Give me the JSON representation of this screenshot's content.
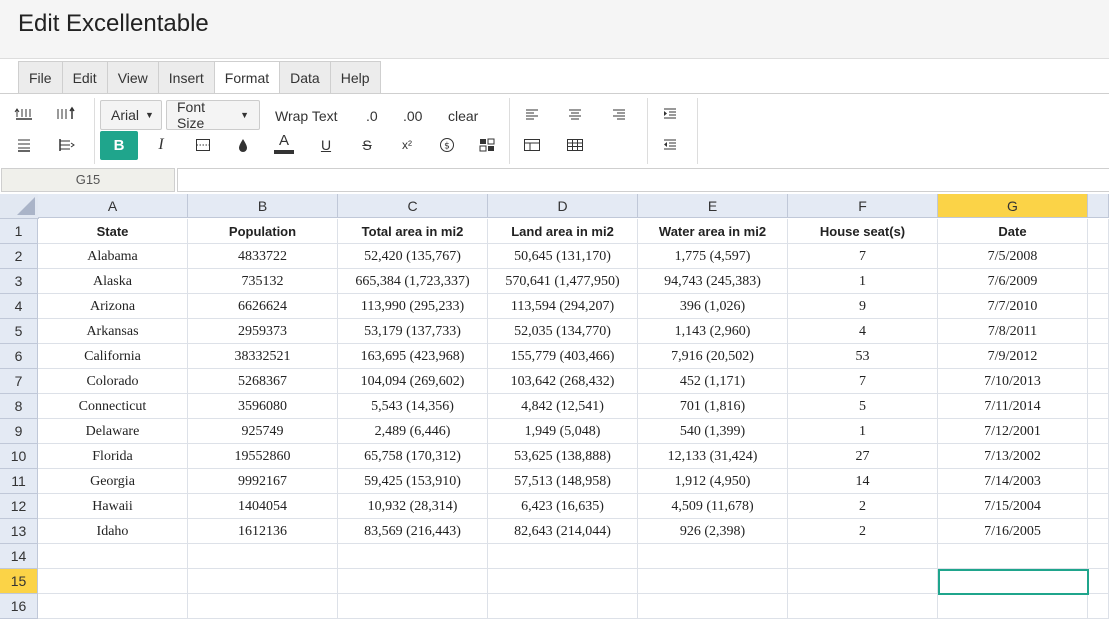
{
  "app": {
    "title": "Edit Excellentable"
  },
  "menu": {
    "tabs": [
      "File",
      "Edit",
      "View",
      "Insert",
      "Format",
      "Data",
      "Help"
    ],
    "active": "Format"
  },
  "toolbar": {
    "font_family": "Arial",
    "font_size": "Font Size",
    "wrap_text": "Wrap Text",
    "dec_decrease": ".0",
    "dec_increase": ".00",
    "clear": "clear",
    "bold": "B",
    "italic": "I",
    "underline": "U",
    "strike": "S",
    "font_color_glyph": "A",
    "superscript": "x²",
    "accent_color": "#1fa58c"
  },
  "formula": {
    "cell_ref": "G15",
    "value": ""
  },
  "sheet": {
    "columns": [
      "A",
      "B",
      "C",
      "D",
      "E",
      "F",
      "G"
    ],
    "selected_column": "G",
    "selected_row": "15",
    "row_numbers": [
      "1",
      "2",
      "3",
      "4",
      "5",
      "6",
      "7",
      "8",
      "9",
      "10",
      "11",
      "12",
      "13",
      "14",
      "15",
      "16"
    ],
    "rows": [
      [
        "State",
        "Population",
        "Total area in mi2",
        "Land area in mi2",
        "Water area in mi2",
        "House seat(s)",
        "Date"
      ],
      [
        "Alabama",
        "4833722",
        "52,420 (135,767)",
        "50,645 (131,170)",
        "1,775 (4,597)",
        "7",
        "7/5/2008"
      ],
      [
        "Alaska",
        "735132",
        "665,384 (1,723,337)",
        "570,641 (1,477,950)",
        "94,743 (245,383)",
        "1",
        "7/6/2009"
      ],
      [
        "Arizona",
        "6626624",
        "113,990 (295,233)",
        "113,594 (294,207)",
        "396 (1,026)",
        "9",
        "7/7/2010"
      ],
      [
        "Arkansas",
        "2959373",
        "53,179 (137,733)",
        "52,035 (134,770)",
        "1,143 (2,960)",
        "4",
        "7/8/2011"
      ],
      [
        "California",
        "38332521",
        "163,695 (423,968)",
        "155,779 (403,466)",
        "7,916 (20,502)",
        "53",
        "7/9/2012"
      ],
      [
        "Colorado",
        "5268367",
        "104,094 (269,602)",
        "103,642 (268,432)",
        "452 (1,171)",
        "7",
        "7/10/2013"
      ],
      [
        "Connecticut",
        "3596080",
        "5,543 (14,356)",
        "4,842 (12,541)",
        "701 (1,816)",
        "5",
        "7/11/2014"
      ],
      [
        "Delaware",
        "925749",
        "2,489 (6,446)",
        "1,949 (5,048)",
        "540 (1,399)",
        "1",
        "7/12/2001"
      ],
      [
        "Florida",
        "19552860",
        "65,758 (170,312)",
        "53,625 (138,888)",
        "12,133 (31,424)",
        "27",
        "7/13/2002"
      ],
      [
        "Georgia",
        "9992167",
        "59,425 (153,910)",
        "57,513 (148,958)",
        "1,912 (4,950)",
        "14",
        "7/14/2003"
      ],
      [
        "Hawaii",
        "1404054",
        "10,932 (28,314)",
        "6,423 (16,635)",
        "4,509 (11,678)",
        "2",
        "7/15/2004"
      ],
      [
        "Idaho",
        "1612136",
        "83,569 (216,443)",
        "82,643 (214,044)",
        "926 (2,398)",
        "2",
        "7/16/2005"
      ],
      [
        "",
        "",
        "",
        "",
        "",
        "",
        ""
      ],
      [
        "",
        "",
        "",
        "",
        "",
        "",
        ""
      ],
      [
        "",
        "",
        "",
        "",
        "",
        "",
        ""
      ]
    ]
  }
}
